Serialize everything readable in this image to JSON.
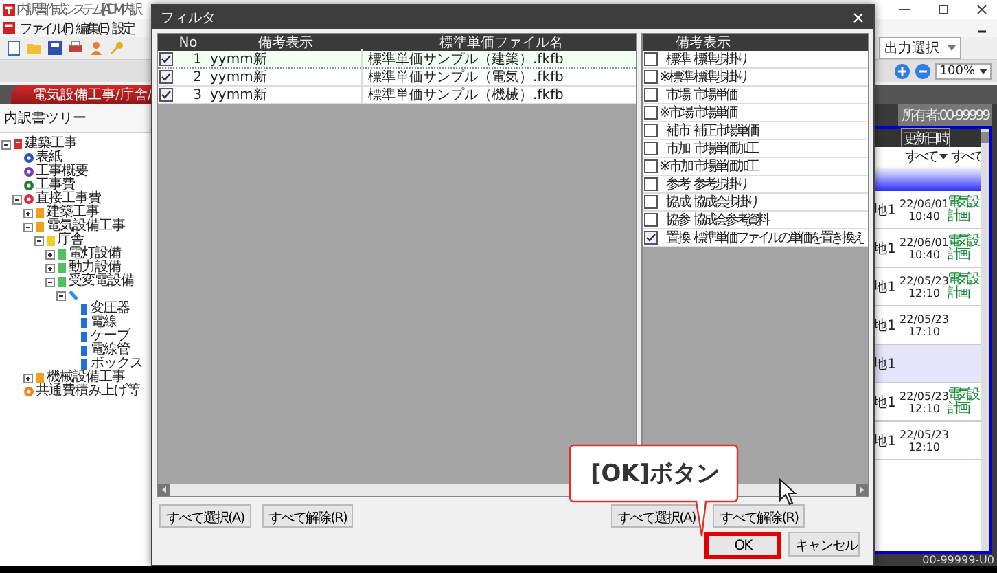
{
  "app": {
    "title": "内訳書作成システム - [ADM内訳",
    "menu": [
      "ファイル(F)",
      "編集(E)",
      "設定"
    ],
    "output_select": "出力選択",
    "zoom": "100%",
    "section_tab": "電気設備工事/庁舎/",
    "tree_title": "内訳書ツリー",
    "owner": "所有者:00-99999",
    "status": "00-99999-U0"
  },
  "tree": [
    {
      "label": "建築工事",
      "kind": "book",
      "color": "#d03030",
      "expanded": true,
      "children": [
        {
          "label": "表紙",
          "kind": "dot",
          "color": "#3050c0"
        },
        {
          "label": "工事概要",
          "kind": "dot",
          "color": "#7040b0"
        },
        {
          "label": "工事費",
          "kind": "dot",
          "color": "#208030"
        },
        {
          "label": "直接工事費",
          "kind": "dot",
          "color": "#d03040",
          "expanded": true,
          "children": [
            {
              "label": "建築工事",
              "kind": "folder",
              "color": "#f0a020",
              "expanded": false
            },
            {
              "label": "電気設備工事",
              "kind": "folder",
              "color": "#f0a020",
              "expanded": true,
              "children": [
                {
                  "label": "庁舎",
                  "kind": "folder",
                  "color": "#f0d020",
                  "expanded": true,
                  "children": [
                    {
                      "label": "電灯設備",
                      "kind": "folder",
                      "color": "#50c060",
                      "expanded": false
                    },
                    {
                      "label": "動力設備",
                      "kind": "folder",
                      "color": "#50c060",
                      "expanded": false
                    },
                    {
                      "label": "受変電設備",
                      "kind": "folder",
                      "color": "#50c060",
                      "expanded": true,
                      "children": [
                        {
                          "kind": "pen",
                          "color": "#3090e0",
                          "expanded": true,
                          "children": [
                            {
                              "label": "変圧器",
                              "kind": "page",
                              "color": "#1e6fe0"
                            },
                            {
                              "label": "電線",
                              "kind": "page",
                              "color": "#1e6fe0"
                            },
                            {
                              "label": "ケーブ",
                              "kind": "page",
                              "color": "#1e6fe0"
                            },
                            {
                              "label": "電線管",
                              "kind": "page",
                              "color": "#1e6fe0"
                            },
                            {
                              "label": "ボックス",
                              "kind": "page",
                              "color": "#1e6fe0"
                            }
                          ]
                        }
                      ]
                    }
                  ]
                }
              ]
            },
            {
              "label": "機械設備工事",
              "kind": "folder",
              "color": "#f0a020",
              "expanded": false
            }
          ]
        },
        {
          "label": "共通費積み上げ等",
          "kind": "dot",
          "color": "#f08020"
        }
      ]
    }
  ],
  "bg_table": {
    "filters": [
      "すべて",
      "すべて"
    ],
    "header": "更新日時",
    "rows": [
      {
        "place": "地1",
        "date": "22/06/01",
        "time": "10:40",
        "tag": "電気設計画",
        "highlight": false
      },
      {
        "place": "地1",
        "date": "22/06/01",
        "time": "10:40",
        "tag": "電気設計画",
        "highlight": false
      },
      {
        "place": "地1",
        "date": "22/05/23",
        "time": "12:10",
        "tag": "電気設計画",
        "highlight": false
      },
      {
        "place": "地1",
        "date": "22/05/23",
        "time": "17:10",
        "highlight": false
      },
      {
        "place": "地1",
        "highlight": true
      },
      {
        "place": "地1",
        "date": "22/05/23",
        "time": "12:10",
        "tag": "電気設計画",
        "highlight": false
      },
      {
        "place": "地1",
        "date": "22/05/23",
        "time": "12:10",
        "highlight": false
      }
    ]
  },
  "dialog": {
    "title": "フィルタ",
    "files": {
      "columns": [
        "No",
        "備考表示",
        "標準単価ファイル名"
      ],
      "rows": [
        {
          "checked": true,
          "no": "1",
          "note": "yymm新",
          "file": "標準単価サンプル（建築）.fkfb",
          "selected": true
        },
        {
          "checked": true,
          "no": "2",
          "note": "yymm新",
          "file": "標準単価サンプル（電気）.fkfb",
          "selected": false
        },
        {
          "checked": true,
          "no": "3",
          "note": "yymm新",
          "file": "標準単価サンプル（機械）.fkfb",
          "selected": false
        }
      ]
    },
    "notes": {
      "column": "備考表示",
      "rows": [
        {
          "checked": false,
          "code": "標準",
          "text": "標準歩掛り"
        },
        {
          "checked": false,
          "code": "※標準",
          "text": "標準歩掛り"
        },
        {
          "checked": false,
          "code": "市場",
          "text": "市場単価"
        },
        {
          "checked": false,
          "code": "※市場",
          "text": "市場単価"
        },
        {
          "checked": false,
          "code": "補市",
          "text": "補正市場単価"
        },
        {
          "checked": false,
          "code": "市加",
          "text": "市場単価加工"
        },
        {
          "checked": false,
          "code": "※市加",
          "text": "市場単価加工"
        },
        {
          "checked": false,
          "code": "参考",
          "text": "参考歩掛り"
        },
        {
          "checked": false,
          "code": "協成",
          "text": "協成会歩掛り"
        },
        {
          "checked": false,
          "code": "協参",
          "text": "協成会参考資料"
        },
        {
          "checked": true,
          "code": "置換",
          "text": "標準単価ファイルの単価を置き換え"
        }
      ]
    },
    "left_buttons": [
      "すべて選択(A)",
      "すべて解除(R)"
    ],
    "right_buttons": [
      "すべて選択(A)",
      "すべて解除(R)"
    ],
    "ok": "OK",
    "cancel": "キャンセル"
  },
  "callout": "[OK]ボタン"
}
